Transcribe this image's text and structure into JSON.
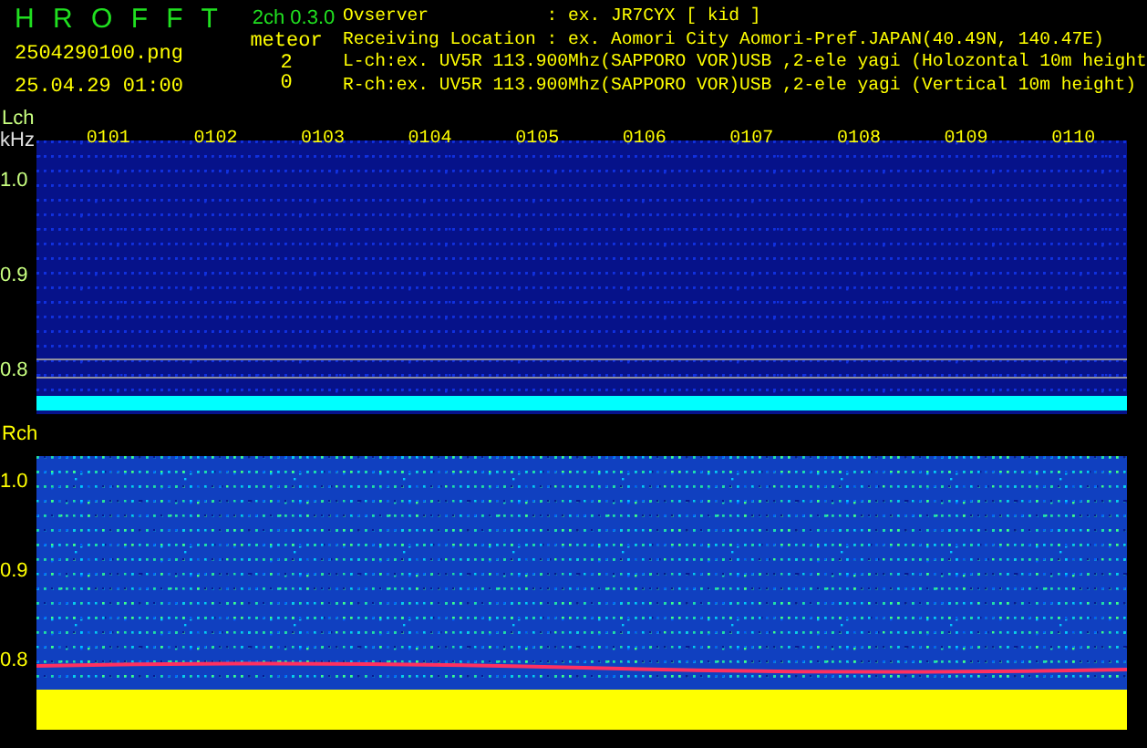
{
  "app": {
    "title": "H R O F F T",
    "version": "2ch 0.3.0"
  },
  "file": {
    "name": "2504290100.png",
    "datetime": "25.04.29 01:00"
  },
  "meteor": {
    "label": "meteor",
    "counts": [
      "2",
      "0"
    ]
  },
  "info": [
    "Ovserver           : ex. JR7CYX [ kid ]",
    "Receiving Location : ex. Aomori City Aomori-Pref.JAPAN(40.49N, 140.47E)",
    "L-ch:ex. UV5R 113.900Mhz(SAPPORO VOR)USB ,2-ele yagi (Holozontal 10m height",
    "R-ch:ex. UV5R 113.900Mhz(SAPPORO VOR)USB ,2-ele yagi (Vertical 10m height)"
  ],
  "panels": [
    {
      "kind": "lch",
      "channel": "Lch",
      "unit": "kHz",
      "times": [
        "0101",
        "0102",
        "0103",
        "0104",
        "0105",
        "0106",
        "0107",
        "0108",
        "0109",
        "0110"
      ],
      "yticks": [
        "1.0",
        "0.9",
        "0.8"
      ]
    },
    {
      "kind": "rch",
      "channel": "Rch",
      "yticks": [
        "1.0",
        "0.9",
        "0.8"
      ]
    }
  ]
}
